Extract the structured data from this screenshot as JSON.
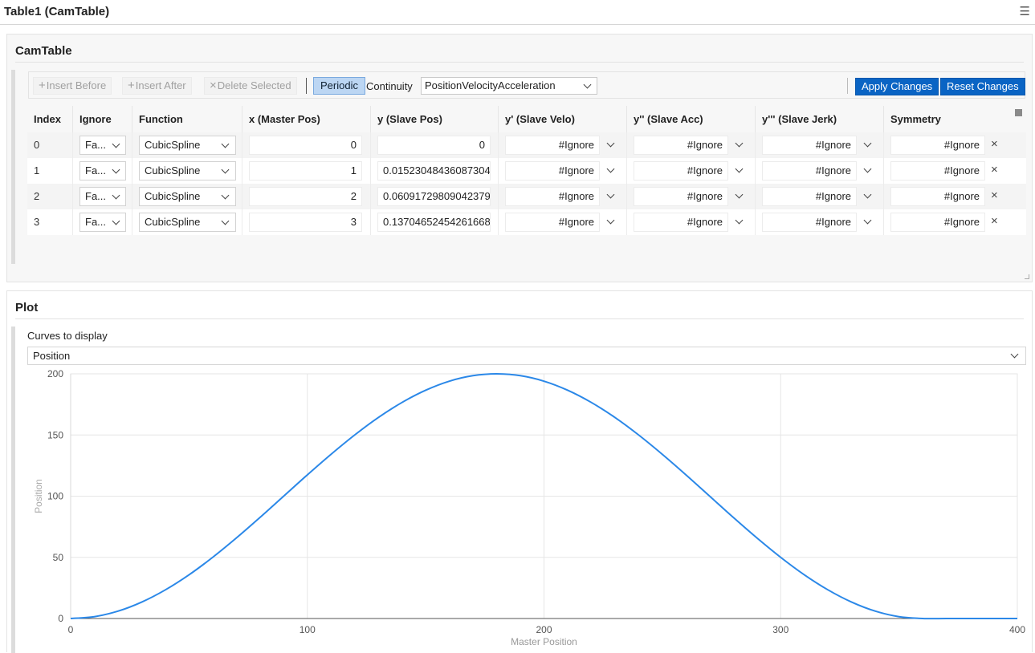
{
  "window": {
    "title": "Table1 (CamTable)",
    "menu_icon": "hamburger-menu-icon"
  },
  "camtable": {
    "heading": "CamTable",
    "toolbar": {
      "insert_before": "Insert Before",
      "insert_after": "Insert After",
      "delete_selected": "Delete Selected",
      "periodic": "Periodic",
      "continuity_label": "Continuity",
      "continuity_value": "PositionVelocityAcceleration",
      "apply": "Apply Changes",
      "reset": "Reset Changes"
    },
    "columns": [
      "Index",
      "Ignore",
      "Function",
      "x (Master Pos)",
      "y (Slave Pos)",
      "y' (Slave Velo)",
      "y'' (Slave Acc)",
      "y''' (Slave Jerk)",
      "Symmetry"
    ],
    "rows": [
      {
        "index": "0",
        "ignore": "Fa...",
        "function": "CubicSpline",
        "x": "0",
        "y": "0",
        "velo": "#Ignore",
        "acc": "#Ignore",
        "jerk": "#Ignore",
        "symmetry": "#Ignore"
      },
      {
        "index": "1",
        "ignore": "Fa...",
        "function": "CubicSpline",
        "x": "1",
        "y": "0.01523048436087304",
        "velo": "#Ignore",
        "acc": "#Ignore",
        "jerk": "#Ignore",
        "symmetry": "#Ignore"
      },
      {
        "index": "2",
        "ignore": "Fa...",
        "function": "CubicSpline",
        "x": "2",
        "y": "0.06091729809042379",
        "velo": "#Ignore",
        "acc": "#Ignore",
        "jerk": "#Ignore",
        "symmetry": "#Ignore"
      },
      {
        "index": "3",
        "ignore": "Fa...",
        "function": "CubicSpline",
        "x": "3",
        "y": "0.13704652454261668",
        "velo": "#Ignore",
        "acc": "#Ignore",
        "jerk": "#Ignore",
        "symmetry": "#Ignore"
      }
    ]
  },
  "plot": {
    "heading": "Plot",
    "curves_label": "Curves to display",
    "curves_value": "Position"
  },
  "chart_data": {
    "type": "line",
    "xlabel": "Master Position",
    "ylabel": "Position",
    "xlim": [
      0,
      400
    ],
    "ylim": [
      0,
      200
    ],
    "xticks": [
      0,
      100,
      200,
      300,
      400
    ],
    "yticks": [
      0,
      50,
      100,
      150,
      200
    ],
    "grid": true,
    "line_color": "#2b88e8",
    "series": [
      {
        "x": [
          0,
          10,
          20,
          30,
          40,
          50,
          60,
          70,
          80,
          90,
          100,
          110,
          120,
          130,
          140,
          150,
          160,
          170,
          180,
          190,
          200,
          210,
          220,
          230,
          240,
          250,
          260,
          270,
          280,
          290,
          300,
          310,
          320,
          330,
          340,
          350,
          360,
          370,
          380,
          390,
          400
        ],
        "y": [
          0,
          1.5,
          6.0,
          13.4,
          23.4,
          35.7,
          50.0,
          65.8,
          82.6,
          100.0,
          117.4,
          134.2,
          150.0,
          164.3,
          176.6,
          186.6,
          194.0,
          198.5,
          200.0,
          198.5,
          194.0,
          186.6,
          176.6,
          164.3,
          150.0,
          134.2,
          117.4,
          100.0,
          82.6,
          65.8,
          50.0,
          35.7,
          23.4,
          13.4,
          6.0,
          1.5,
          0,
          0,
          0,
          0,
          0
        ]
      }
    ]
  }
}
